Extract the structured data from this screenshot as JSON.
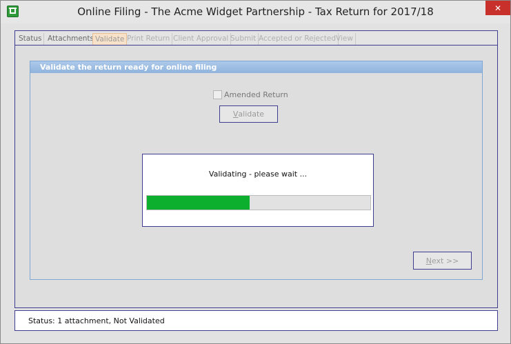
{
  "window": {
    "title": "Online Filing - The Acme Widget Partnership - Tax Return for 2017/18",
    "close_label": "✕"
  },
  "tabs": [
    {
      "label": "Status",
      "state": "normal"
    },
    {
      "label": "Attachments",
      "state": "normal"
    },
    {
      "label": "Validate",
      "state": "active"
    },
    {
      "label": "Print Return",
      "state": "disabled"
    },
    {
      "label": "Client Approval",
      "state": "disabled"
    },
    {
      "label": "Submit",
      "state": "disabled"
    },
    {
      "label": "Accepted or Rejected",
      "state": "disabled"
    },
    {
      "label": "View",
      "state": "disabled"
    }
  ],
  "validate_panel": {
    "header": "Validate the return ready for online filing",
    "amended_label": "Amended Return",
    "amended_checked": false,
    "validate_first": "V",
    "validate_rest": "alidate",
    "next_first": "N",
    "next_rest": "ext >>"
  },
  "progress": {
    "message": "Validating - please wait ...",
    "fraction": 0.46,
    "color": "#0cb02e"
  },
  "status": {
    "text": "Status: 1 attachment, Not Validated"
  },
  "colors": {
    "border_accent": "#3d3d8f",
    "group_header": "#9bbde3",
    "active_tab": "#f7e2c9",
    "close_button": "#c7302b"
  }
}
